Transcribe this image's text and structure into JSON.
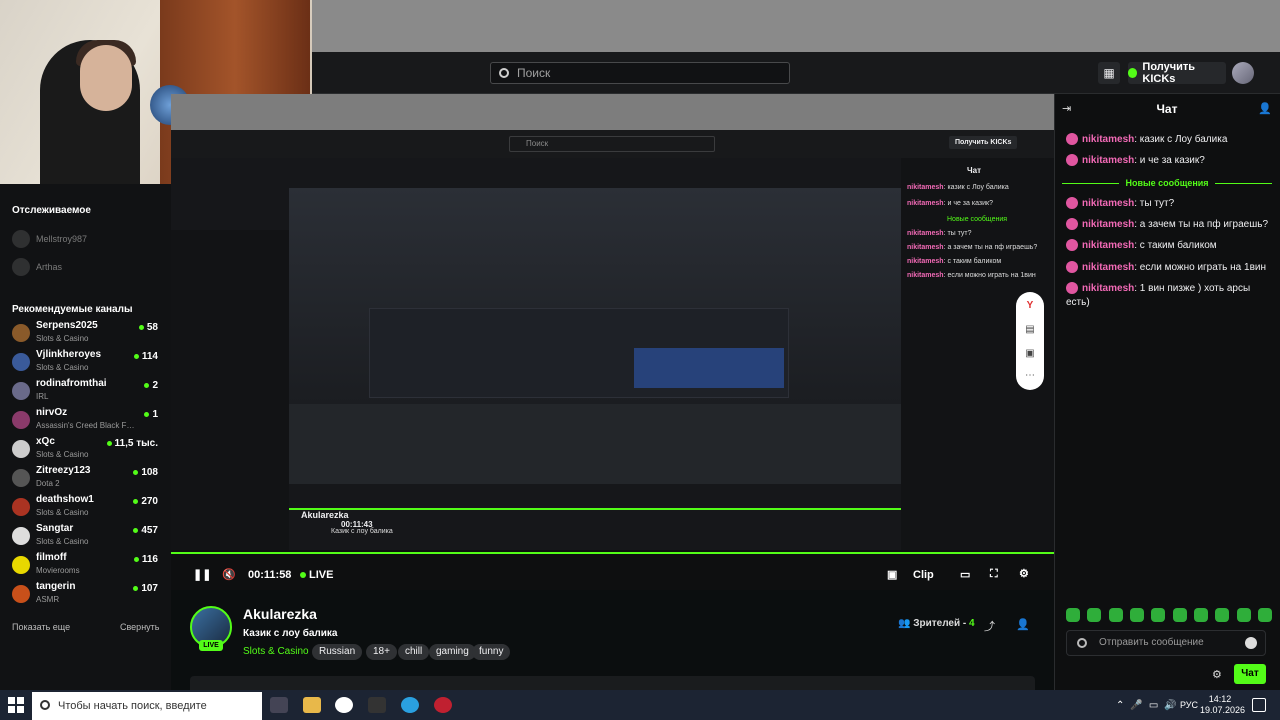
{
  "header": {
    "search_placeholder": "Поиск",
    "kicks_label": "Получить KICKs"
  },
  "sidebar": {
    "following_title": "Отслеживаемое",
    "following": [
      {
        "name": "Mellstroy987"
      },
      {
        "name": "Arthas"
      }
    ],
    "recommended_title": "Рекомендуемые каналы",
    "channels": [
      {
        "name": "Serpens2025",
        "category": "Slots & Casino",
        "viewers": "58",
        "color": "#8a5a2a"
      },
      {
        "name": "Vjlinkheroyes",
        "category": "Slots & Casino",
        "viewers": "114",
        "color": "#3a5a9a"
      },
      {
        "name": "rodinafromthai",
        "category": "IRL",
        "viewers": "2",
        "color": "#6a6a8a"
      },
      {
        "name": "nirvOz",
        "category": "Assassin's Creed Black F…",
        "viewers": "1",
        "color": "#8a3a6a"
      },
      {
        "name": "xQc",
        "category": "Slots & Casino",
        "viewers": "11,5 тыс.",
        "color": "#cccccc"
      },
      {
        "name": "Zitreezy123",
        "category": "Dota 2",
        "viewers": "108",
        "color": "#555555"
      },
      {
        "name": "deathshow1",
        "category": "Slots & Casino",
        "viewers": "270",
        "color": "#aa3322"
      },
      {
        "name": "Sangtar",
        "category": "Slots & Casino",
        "viewers": "457",
        "color": "#dddddd"
      },
      {
        "name": "filmoff",
        "category": "Movierooms",
        "viewers": "116",
        "color": "#e8d800"
      },
      {
        "name": "tangerin",
        "category": "ASMR",
        "viewers": "107",
        "color": "#c8501a"
      }
    ],
    "show_more": "Показать еще",
    "collapse": "Свернуть"
  },
  "player": {
    "time": "00:11:58",
    "live_label": "LIVE",
    "clip_label": "Clip",
    "inner_time": "00:11:43",
    "inner_streamer": "Akularezka",
    "inner_title": "Казик с лоу балика",
    "inner_search": "Поиск",
    "inner_kicks": "Получить KICKs",
    "inner_chat_title": "Чат",
    "inner_chat": [
      {
        "user": "nikitamesh",
        "text": ": казик с Лоу балика"
      },
      {
        "user": "nikitamesh",
        "text": ": и че за казик?"
      },
      {
        "user": "",
        "text": "Новые сообщения"
      },
      {
        "user": "nikitamesh",
        "text": ": ты тут?"
      },
      {
        "user": "nikitamesh",
        "text": ": а зачем ты на пф играешь?"
      },
      {
        "user": "nikitamesh",
        "text": ": с таким баликом"
      },
      {
        "user": "nikitamesh",
        "text": ": если можно играть на 1вин"
      }
    ]
  },
  "stream": {
    "streamer": "Akularezka",
    "live_badge": "LIVE",
    "title": "Казик с лоу балика",
    "category": "Slots & Casino",
    "tags": [
      "Russian",
      "18+",
      "chill",
      "gaming",
      "funny"
    ],
    "viewers_label": "Зрителей -",
    "viewers_count": "4"
  },
  "chat": {
    "title": "Чат",
    "new_messages": "Новые сообщения",
    "messages_before": [
      {
        "user": "nikitamesh",
        "text": ": казик с Лоу балика"
      },
      {
        "user": "nikitamesh",
        "text": ": и че за казик?"
      }
    ],
    "messages_after": [
      {
        "user": "nikitamesh",
        "text": ": ты тут?"
      },
      {
        "user": "nikitamesh",
        "text": ": а зачем ты на пф играешь?"
      },
      {
        "user": "nikitamesh",
        "text": ": с таким баликом"
      },
      {
        "user": "nikitamesh",
        "text": ": если можно играть на 1вин"
      },
      {
        "user": "nikitamesh",
        "text": ": 1 вин пизже ) хоть арсы есть)"
      }
    ],
    "input_placeholder": "Отправить сообщение",
    "send_label": "Чат"
  },
  "taskbar": {
    "search_placeholder": "Чтобы начать поиск, введите",
    "language": "РУС",
    "time": "14:12",
    "date": "19.07.2026"
  },
  "colors": {
    "accent": "#53fc18",
    "username": "#f26ab6",
    "background": "#0b0e0f"
  }
}
